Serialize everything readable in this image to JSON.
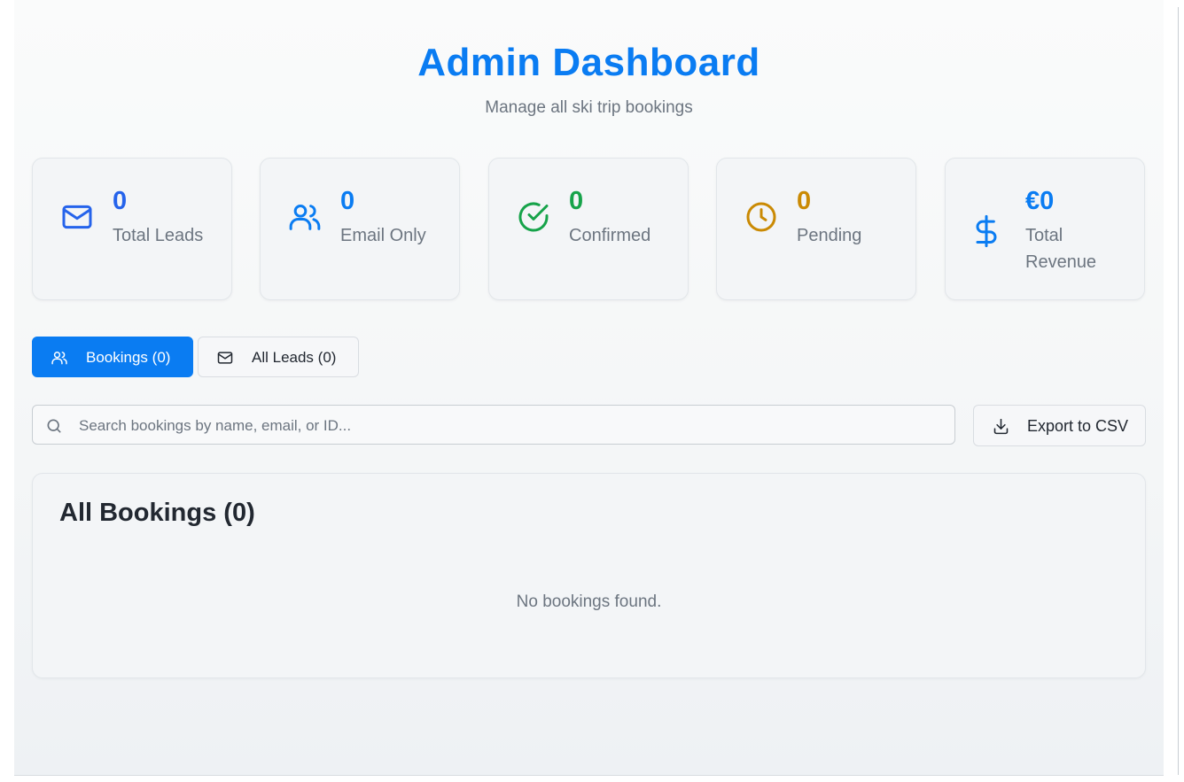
{
  "header": {
    "title": "Admin Dashboard",
    "subtitle": "Manage all ski trip bookings"
  },
  "stats": [
    {
      "value": "0",
      "label": "Total Leads",
      "icon": "mail-icon",
      "color": "#2563eb"
    },
    {
      "value": "0",
      "label": "Email Only",
      "icon": "users-icon",
      "color": "#0a7cf2"
    },
    {
      "value": "0",
      "label": "Confirmed",
      "icon": "check-circle-icon",
      "color": "#16a34a"
    },
    {
      "value": "0",
      "label": "Pending",
      "icon": "clock-icon",
      "color": "#ca8a04"
    },
    {
      "value": "€0",
      "label": "Total Revenue",
      "icon": "dollar-icon",
      "color": "#0a7cf2"
    }
  ],
  "tabs": [
    {
      "label": "Bookings (0)",
      "icon": "users-icon",
      "active": true
    },
    {
      "label": "All Leads (0)",
      "icon": "mail-icon",
      "active": false
    }
  ],
  "search": {
    "placeholder": "Search bookings by name, email, or ID...",
    "value": ""
  },
  "export": {
    "label": "Export to CSV",
    "icon": "download-icon"
  },
  "bookings_panel": {
    "title": "All Bookings (0)",
    "empty_text": "No bookings found."
  },
  "colors": {
    "accent": "#0a7cf2",
    "muted_text": "#6c7580",
    "dark_text": "#222831"
  }
}
